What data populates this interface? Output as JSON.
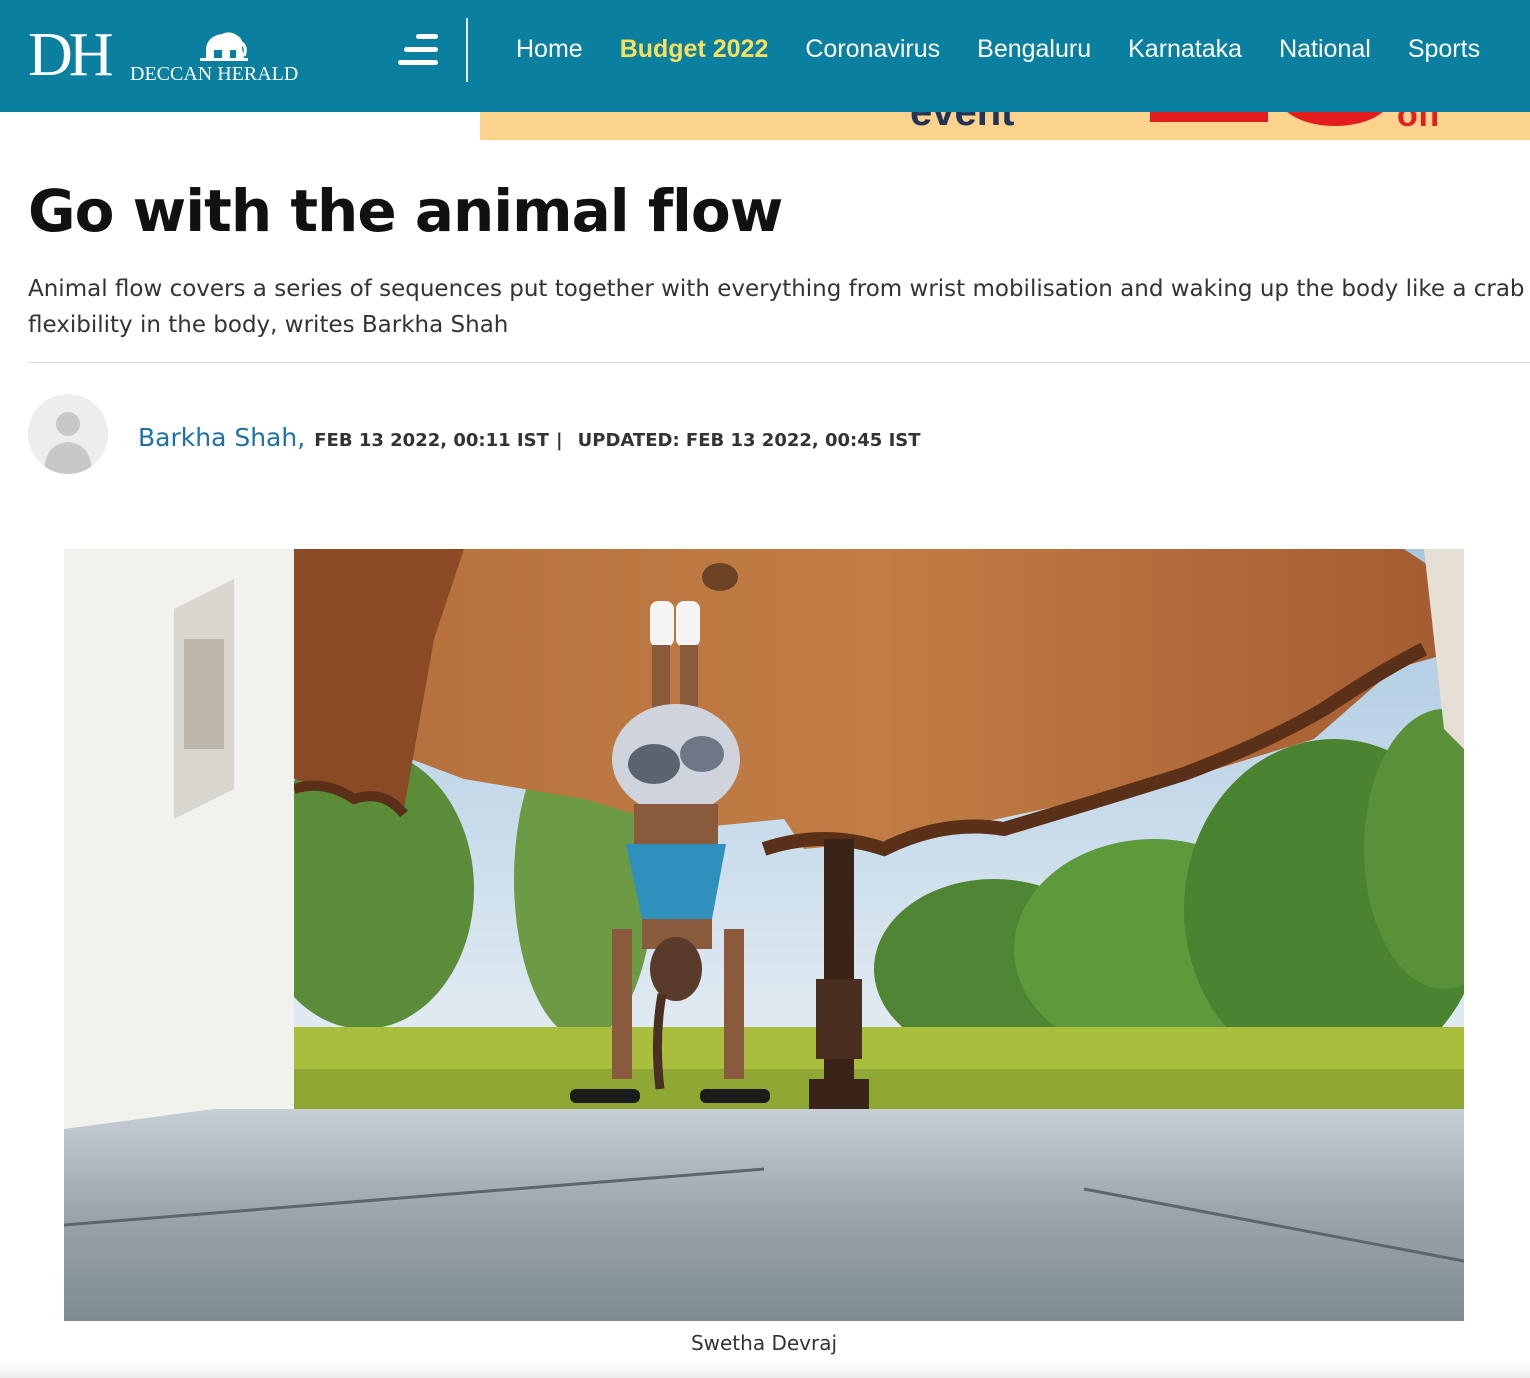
{
  "header": {
    "logo_mark": "DH",
    "logo_name": "DECCAN HERALD",
    "nav": [
      {
        "label": "Home"
      },
      {
        "label": "Budget 2022",
        "highlight": true
      },
      {
        "label": "Coronavirus"
      },
      {
        "label": "Bengaluru"
      },
      {
        "label": "Karnataka"
      },
      {
        "label": "National"
      },
      {
        "label": "Sports"
      }
    ],
    "brand_color": "#0a7fa0",
    "highlight_color": "#f7e15c"
  },
  "ad": {
    "word": "event",
    "suffix": "off",
    "background": "#fbd38d"
  },
  "article": {
    "headline": "Go with the animal flow",
    "summary": "Animal flow covers a series of sequences put together with everything from wrist mobilisation and waking up the body like a crab to flexibility in the body, writes Barkha Shah",
    "author": "Barkha Shah,",
    "published": "FEB 13 2022, 00:11 IST",
    "separator": "|",
    "updated": "UPDATED: FEB 13 2022, 00:45 IST",
    "image_caption": "Swetha Devraj",
    "author_link_color": "#1e70aa"
  }
}
